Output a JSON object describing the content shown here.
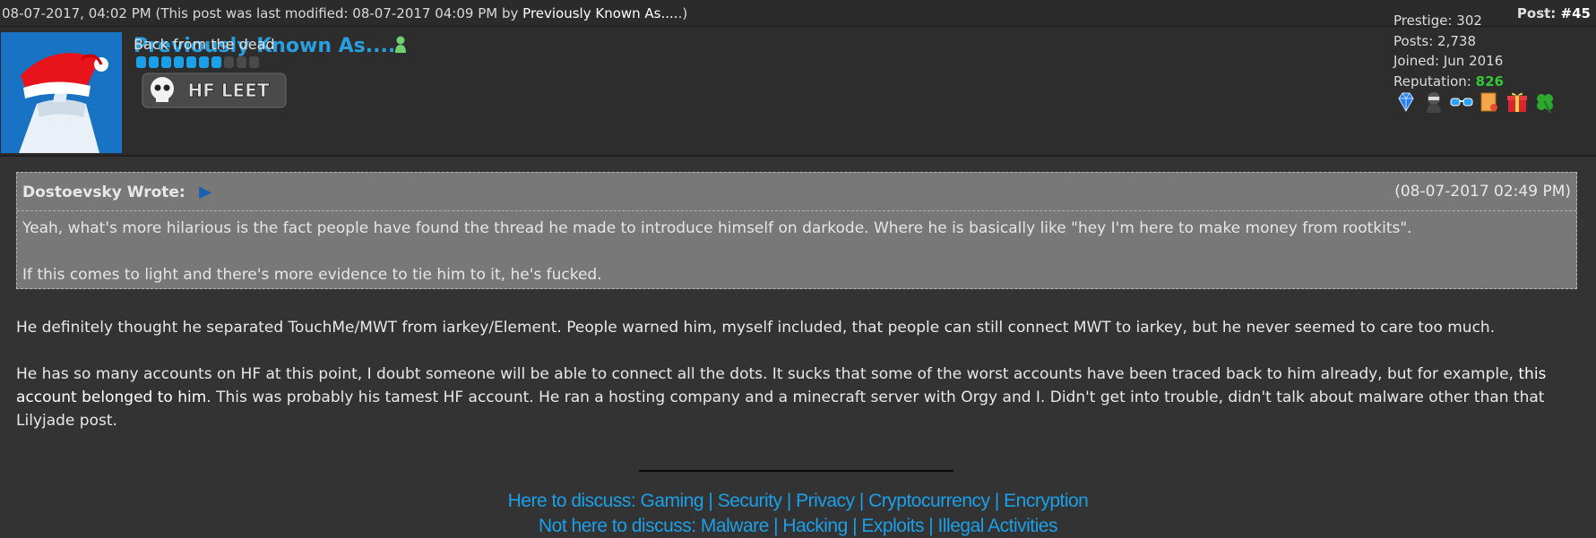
{
  "post_meta": {
    "datetime": "08-07-2017, 04:02 PM",
    "modified_prefix": "(This post was last modified: 08-07-2017 04:09 PM by",
    "modified_by": "Previously Known As....",
    "modified_suffix": ".)",
    "post_label": "Post:",
    "post_number": "#45"
  },
  "author": {
    "username": "Previously Known As....",
    "user_title": "Back from the dead",
    "stars_filled": 7,
    "stars_total": 10,
    "group_badge_text": "HF LEET",
    "online_status_icon": "user-online-icon"
  },
  "stats": {
    "prestige_label": "Prestige:",
    "prestige": "302",
    "posts_label": "Posts:",
    "posts": "2,738",
    "joined_label": "Joined:",
    "joined": "Jun 2016",
    "reputation_label": "Reputation:",
    "reputation": "826",
    "reputation_color": "#34c934",
    "awards": [
      "diamond-award-icon",
      "ninja-award-icon",
      "glasses-award-icon",
      "scroll-award-icon",
      "gift-award-icon",
      "clover-award-icon"
    ]
  },
  "quote": {
    "author_line": "Dostoevsky Wrote:",
    "timestamp": "(08-07-2017 02:49 PM)",
    "paragraphs": [
      "Yeah, what's more hilarious is the fact people have found the thread he made to introduce himself on darkode. Where he is basically like \"hey I'm here to make money from rootkits\".",
      "If this comes to light and there's more evidence to tie him to it, he's fucked."
    ]
  },
  "message": {
    "p1": "He definitely thought he separated TouchMe/MWT from iarkey/Element. People warned him, myself included, that people can still connect MWT to iarkey, but he never seemed to care too much.",
    "p2_before": "He has so many accounts on HF at this point, I doubt someone will be able to connect all the dots. It sucks that some of the worst accounts have been traced back to him already, but for example, ",
    "p2_link": "this account belonged to him",
    "p2_after": ". This was probably his tamest HF account. He ran a hosting company and a minecraft server with Orgy and I. Didn't get into trouble, didn't talk about malware other than that Lilyjade post."
  },
  "signature": {
    "line1": "Here to discuss: Gaming | Security | Privacy | Cryptocurrency | Encryption",
    "line2": "Not here to discuss: Malware | Hacking | Exploits | Illegal Activities",
    "color": "#1aa0e8"
  }
}
